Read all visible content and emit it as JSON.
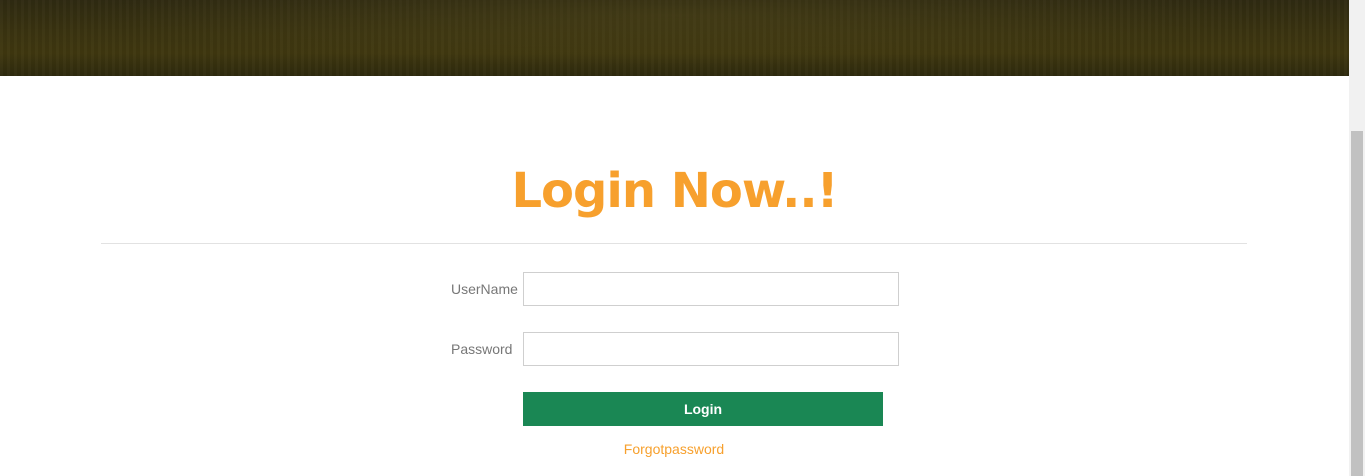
{
  "login": {
    "title": "Login Now..!",
    "username_label": "UserName",
    "username_value": "",
    "password_label": "Password",
    "password_value": "",
    "submit_label": "Login",
    "forgot_label": "Forgotpassword"
  },
  "colors": {
    "accent": "#f7a02d",
    "button": "#1a8754"
  }
}
